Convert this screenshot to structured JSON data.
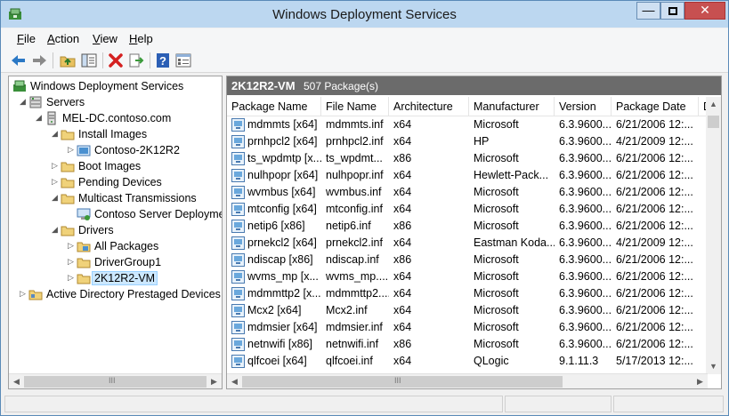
{
  "window": {
    "title": "Windows Deployment Services",
    "controls": {
      "minimize": "—",
      "close": "✕"
    }
  },
  "menu": [
    "File",
    "Action",
    "View",
    "Help"
  ],
  "menu_mnemonics": [
    "F",
    "A",
    "V",
    "H"
  ],
  "toolbar_icons": [
    "back-icon",
    "forward-icon",
    "up-folder-icon",
    "show-hide-tree-icon",
    "delete-icon",
    "export-icon",
    "help-icon",
    "properties-icon"
  ],
  "tree": [
    {
      "label": "Windows Deployment Services",
      "level": 0,
      "arrow": "",
      "icon": "wds-icon"
    },
    {
      "label": "Servers",
      "level": 1,
      "arrow": "open",
      "icon": "servers-icon"
    },
    {
      "label": "MEL-DC.contoso.com",
      "level": 2,
      "arrow": "open",
      "icon": "server-icon"
    },
    {
      "label": "Install Images",
      "level": 3,
      "arrow": "open",
      "icon": "folder-icon"
    },
    {
      "label": "Contoso-2K12R2",
      "level": 4,
      "arrow": "closed",
      "icon": "image-group-icon"
    },
    {
      "label": "Boot Images",
      "level": 3,
      "arrow": "closed",
      "icon": "folder-icon"
    },
    {
      "label": "Pending Devices",
      "level": 3,
      "arrow": "closed",
      "icon": "folder-icon"
    },
    {
      "label": "Multicast Transmissions",
      "level": 3,
      "arrow": "open",
      "icon": "folder-icon"
    },
    {
      "label": "Contoso Server Deployme",
      "level": 4,
      "arrow": "",
      "icon": "multicast-icon"
    },
    {
      "label": "Drivers",
      "level": 3,
      "arrow": "open",
      "icon": "folder-icon"
    },
    {
      "label": "All Packages",
      "level": 4,
      "arrow": "closed",
      "icon": "driver-group-icon"
    },
    {
      "label": "DriverGroup1",
      "level": 4,
      "arrow": "closed",
      "icon": "folder-icon"
    },
    {
      "label": "2K12R2-VM",
      "level": 4,
      "arrow": "closed",
      "icon": "folder-icon",
      "selected": true
    },
    {
      "label": "Active Directory Prestaged Devices",
      "level": 1,
      "arrow": "closed",
      "icon": "ad-folder-icon"
    }
  ],
  "right_pane": {
    "title": "2K12R2-VM",
    "count": "507 Package(s)",
    "columns": [
      "Package Name",
      "File Name",
      "Architecture",
      "Manufacturer",
      "Version",
      "Package Date",
      "D"
    ],
    "rows": [
      [
        "mdmmts [x64]",
        "mdmmts.inf",
        "x64",
        "Microsoft",
        "6.3.9600...",
        "6/21/2006 12:..."
      ],
      [
        "prnhpcl2 [x64]",
        "prnhpcl2.inf",
        "x64",
        "HP",
        "6.3.9600...",
        "4/21/2009 12:..."
      ],
      [
        "ts_wpdmtp [x...",
        "ts_wpdmt...",
        "x86",
        "Microsoft",
        "6.3.9600...",
        "6/21/2006 12:..."
      ],
      [
        "nulhpopr [x64]",
        "nulhpopr.inf",
        "x64",
        "Hewlett-Pack...",
        "6.3.9600...",
        "6/21/2006 12:..."
      ],
      [
        "wvmbus [x64]",
        "wvmbus.inf",
        "x64",
        "Microsoft",
        "6.3.9600...",
        "6/21/2006 12:..."
      ],
      [
        "mtconfig [x64]",
        "mtconfig.inf",
        "x64",
        "Microsoft",
        "6.3.9600...",
        "6/21/2006 12:..."
      ],
      [
        "netip6 [x86]",
        "netip6.inf",
        "x86",
        "Microsoft",
        "6.3.9600...",
        "6/21/2006 12:..."
      ],
      [
        "prnekcl2 [x64]",
        "prnekcl2.inf",
        "x64",
        "Eastman Koda...",
        "6.3.9600...",
        "4/21/2009 12:..."
      ],
      [
        "ndiscap [x86]",
        "ndiscap.inf",
        "x86",
        "Microsoft",
        "6.3.9600...",
        "6/21/2006 12:..."
      ],
      [
        "wvms_mp [x...",
        "wvms_mp....",
        "x64",
        "Microsoft",
        "6.3.9600...",
        "6/21/2006 12:..."
      ],
      [
        "mdmmttp2 [x...",
        "mdmmttp2....",
        "x64",
        "Microsoft",
        "6.3.9600...",
        "6/21/2006 12:..."
      ],
      [
        "Mcx2 [x64]",
        "Mcx2.inf",
        "x64",
        "Microsoft",
        "6.3.9600...",
        "6/21/2006 12:..."
      ],
      [
        "mdmsier [x64]",
        "mdmsier.inf",
        "x64",
        "Microsoft",
        "6.3.9600...",
        "6/21/2006 12:..."
      ],
      [
        "netnwifi [x86]",
        "netnwifi.inf",
        "x86",
        "Microsoft",
        "6.3.9600...",
        "6/21/2006 12:..."
      ],
      [
        "qlfcoei [x64]",
        "qlfcoei.inf",
        "x64",
        "QLogic",
        "9.1.11.3",
        "5/17/2013 12:..."
      ]
    ]
  },
  "scroll_glyphs": {
    "left": "◀",
    "right": "▶",
    "up": "▲",
    "down": "▼",
    "grip": "III"
  },
  "colors": {
    "titlebar": "#bcd7f0",
    "close": "#c75050",
    "header": "#6b6b6b",
    "selection": "#cce8ff"
  }
}
